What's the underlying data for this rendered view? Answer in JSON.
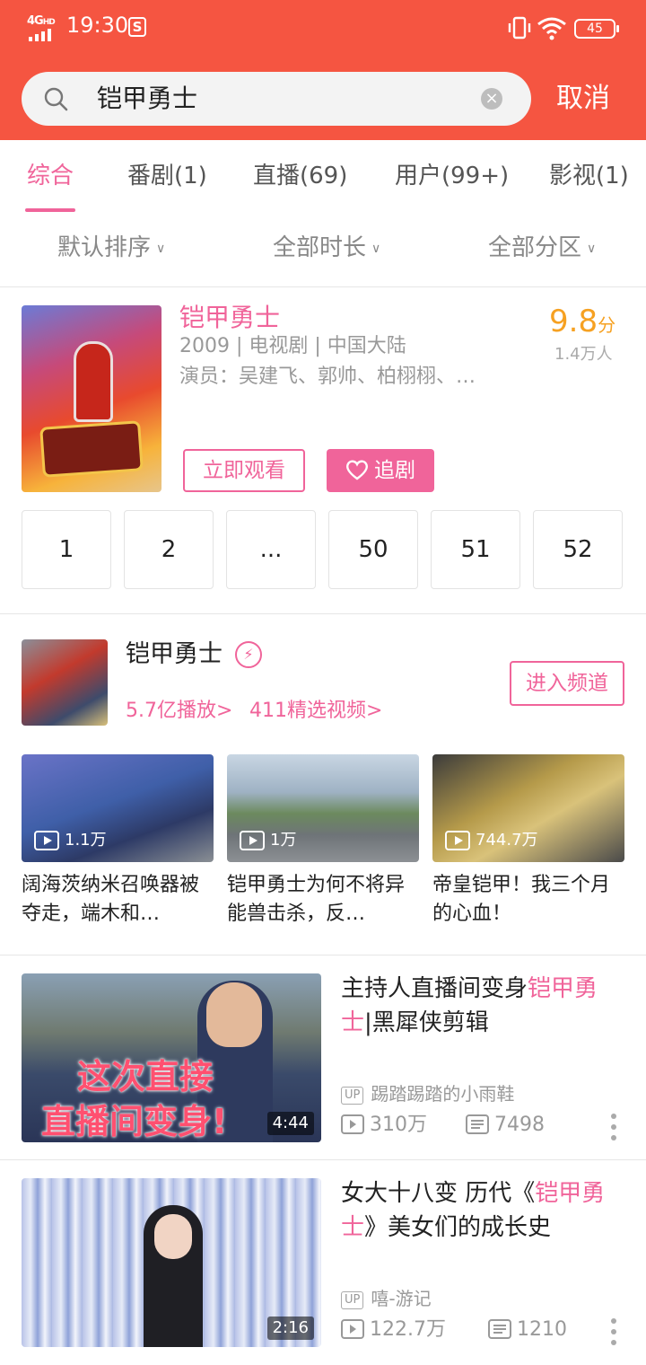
{
  "status_bar": {
    "network": "4G",
    "network_hd": "HD",
    "time": "19:30",
    "s_icon": "S",
    "battery": "45"
  },
  "search": {
    "query": "铠甲勇士",
    "cancel_label": "取消"
  },
  "tabs": [
    {
      "label": "综合"
    },
    {
      "label": "番剧(1)"
    },
    {
      "label": "直播(69)"
    },
    {
      "label": "用户(99+)"
    },
    {
      "label": "影视(1)"
    }
  ],
  "filters": [
    {
      "label": "默认排序"
    },
    {
      "label": "全部时长"
    },
    {
      "label": "全部分区"
    }
  ],
  "drama": {
    "title": "铠甲勇士",
    "meta": "2009 | 电视剧 | 中国大陆",
    "cast": "演员：吴建飞、郭帅、柏栩栩、…",
    "score": "9.8",
    "score_unit": "分",
    "score_count": "1.4万人",
    "watch_label": "立即观看",
    "follow_label": "追剧",
    "episodes": [
      "1",
      "2",
      "...",
      "50",
      "51",
      "52"
    ]
  },
  "channel": {
    "name": "铠甲勇士",
    "plays": "5.7亿播放>",
    "videos": "411精选视频>",
    "enter_label": "进入频道",
    "mini_videos": [
      {
        "views": "1.1万",
        "title": "阔海茨纳米召唤器被夺走，端木和…"
      },
      {
        "views": "1万",
        "title": "铠甲勇士为何不将异能兽击杀，反…"
      },
      {
        "views": "744.7万",
        "title": "帝皇铠甲！我三个月的心血！"
      }
    ]
  },
  "videos": [
    {
      "title_pre": "主持人直播间变身",
      "title_hl": "铠甲勇士",
      "title_post": "|黑犀侠剪辑",
      "thumb_text_1": "这次直接",
      "thumb_text_2": "直播间变身!",
      "duration": "4:44",
      "up_tag": "UP",
      "uploader": "踢踏踢踏的小雨鞋",
      "plays": "310万",
      "comments": "7498"
    },
    {
      "title_pre": "女大十八变 历代《",
      "title_hl": "铠甲勇士",
      "title_post": "》美女们的成长史",
      "duration": "2:16",
      "up_tag": "UP",
      "uploader": "嘻-游记",
      "plays": "122.7万",
      "comments": "1210"
    }
  ],
  "colors": {
    "header": "#f55541",
    "accent_pink": "#f0649a",
    "score_orange": "#f6a122"
  }
}
